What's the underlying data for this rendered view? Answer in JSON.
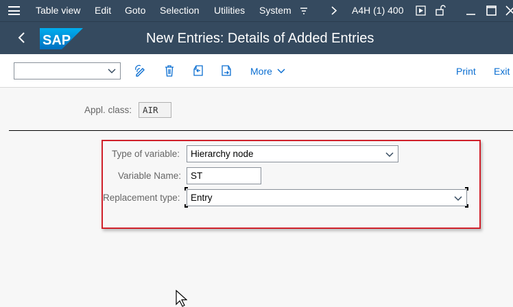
{
  "menubar": {
    "items": [
      "Table view",
      "Edit",
      "Goto",
      "Selection",
      "Utilities",
      "System"
    ],
    "system_info": "A4H (1) 400"
  },
  "header": {
    "title": "New Entries: Details of Added Entries",
    "logo_text": "SAP"
  },
  "toolbar": {
    "select_value": "",
    "more_label": "More",
    "print_label": "Print",
    "exit_label": "Exit"
  },
  "form": {
    "appl_class_label": "Appl. class:",
    "appl_class_value": "AIR",
    "type_of_variable_label": "Type of variable:",
    "type_of_variable_value": "Hierarchy node",
    "variable_name_label": "Variable Name:",
    "variable_name_value": "ST",
    "replacement_type_label": "Replacement type:",
    "replacement_type_value": "Entry"
  },
  "colors": {
    "shell": "#354a5f",
    "highlight_box": "#d0202a",
    "link": "#0a6ed1"
  }
}
